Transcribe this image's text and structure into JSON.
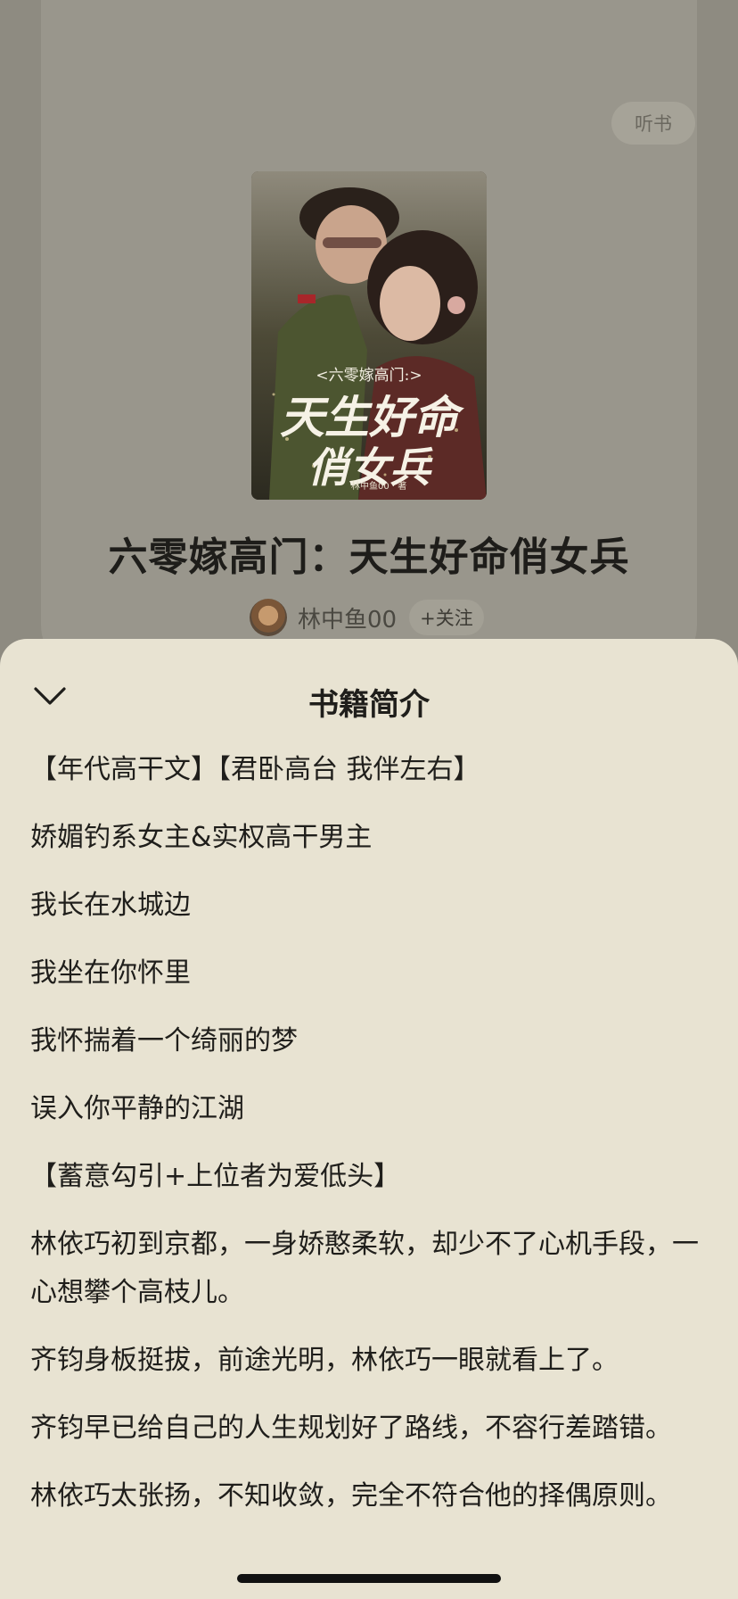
{
  "header": {
    "listen_label": "听书"
  },
  "book": {
    "title": "六零嫁高门：天生好命俏女兵",
    "author": "林中鱼00",
    "follow_label": "+关注",
    "cover": {
      "subtitle": "<六零嫁高门:>",
      "title_line1": "天生好命",
      "title_line2": "俏女兵",
      "author_mark": "林中鱼00 · 著"
    }
  },
  "sheet": {
    "title": "书籍简介",
    "paragraphs": [
      "【年代高干文】【君卧高台 我伴左右】",
      "娇媚钓系女主&实权高干男主",
      "我长在水城边",
      "我坐在你怀里",
      "我怀揣着一个绮丽的梦",
      "误入你平静的江湖",
      "【蓄意勾引+上位者为爱低头】",
      "林依巧初到京都，一身娇憨柔软，却少不了心机手段，一心想攀个高枝儿。",
      "齐钧身板挺拔，前途光明，林依巧一眼就看上了。",
      "齐钧早已给自己的人生规划好了路线，不容行差踏错。",
      "林依巧太张扬，不知收敛，完全不符合他的择偶原则。"
    ]
  },
  "colors": {
    "sheet_bg": "#e8e3d2",
    "overlay": "#8e8b81"
  }
}
